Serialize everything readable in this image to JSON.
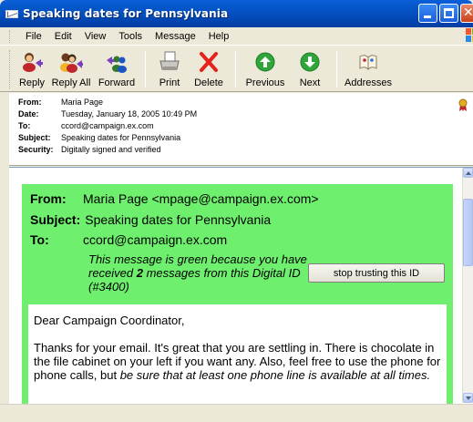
{
  "window": {
    "title": "Speaking dates for Pennsylvania"
  },
  "menu": [
    "File",
    "Edit",
    "View",
    "Tools",
    "Message",
    "Help"
  ],
  "toolbar": [
    {
      "label": "Reply",
      "icon": "reply-icon"
    },
    {
      "label": "Reply All",
      "icon": "reply-all-icon"
    },
    {
      "label": "Forward",
      "icon": "forward-icon"
    },
    {
      "label": "Print",
      "icon": "print-icon"
    },
    {
      "label": "Delete",
      "icon": "delete-icon"
    },
    {
      "label": "Previous",
      "icon": "previous-icon"
    },
    {
      "label": "Next",
      "icon": "next-icon"
    },
    {
      "label": "Addresses",
      "icon": "addresses-icon"
    }
  ],
  "headers": {
    "from_label": "From:",
    "from": "Maria Page",
    "date_label": "Date:",
    "date": "Tuesday, January 18, 2005 10:49 PM",
    "to_label": "To:",
    "to": "ccord@campaign.ex.com",
    "subject_label": "Subject:",
    "subject": "Speaking dates for Pennsylvania",
    "security_label": "Security:",
    "security": "Digitally signed and verified"
  },
  "trust_box": {
    "from_label": "From:",
    "from": "Maria Page <mpage@campaign.ex.com>",
    "subject_label": "Subject:",
    "subject": "Speaking dates for Pennsylvania",
    "to_label": "To:",
    "to": "ccord@campaign.ex.com",
    "note_prefix": "This message is green because you have received ",
    "note_count": "2",
    "note_suffix": " messages from this Digital ID (#3400)",
    "button_label": "stop trusting this ID",
    "color": "#6ef06e"
  },
  "letter": {
    "greeting": "Dear Campaign Coordinator,",
    "body_plain": "Thanks for your email. It's great that you are settling in. There is chocolate in the file cabinet on your left if you want any. Also, feel free to use the phone for phone calls, but ",
    "body_italic": "be sure that at least one phone line is available at all times."
  },
  "colors": {
    "titlebar": "#0453c4",
    "chrome": "#ece9d8"
  }
}
